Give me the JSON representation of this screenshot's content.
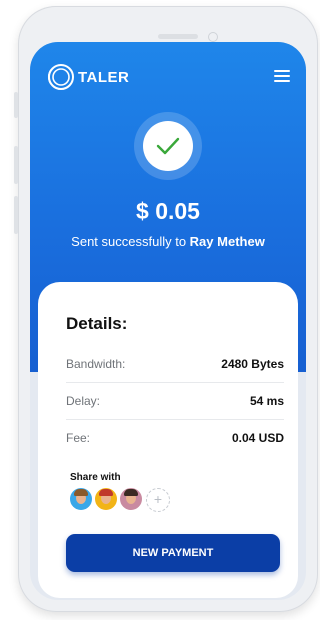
{
  "app": {
    "brand": "TALER"
  },
  "payment": {
    "amount": "$ 0.05",
    "sent_prefix": "Sent successfully to ",
    "recipient": "Ray Methew"
  },
  "details": {
    "title": "Details:",
    "rows": [
      {
        "label": "Bandwidth:",
        "value": "2480 Bytes"
      },
      {
        "label": "Delay:",
        "value": "54 ms"
      },
      {
        "label": "Fee:",
        "value": "0.04 USD"
      }
    ]
  },
  "share": {
    "label": "Share with",
    "add_symbol": "+"
  },
  "actions": {
    "new_payment": "NEW PAYMENT"
  },
  "colors": {
    "hero_blue": "#1a6fde",
    "button_navy": "#0b3ea6",
    "check_green": "#3aa83a"
  },
  "icons": [
    "taler-logo-icon",
    "hamburger-menu-icon",
    "checkmark-icon",
    "plus-icon"
  ]
}
